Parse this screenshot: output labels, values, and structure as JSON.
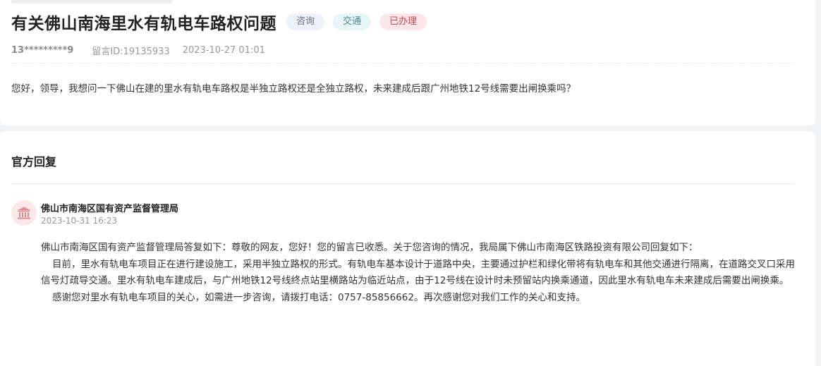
{
  "question": {
    "title": "有关佛山南海里水有轨电车路权问题",
    "tags": [
      "咨询",
      "交通",
      "已办理"
    ],
    "phone": "13*********9",
    "message_id": "留言ID:19135933",
    "date": "2023-10-27 01:01",
    "content": "您好，领导，我想问一下佛山在建的里水有轨电车路权是半独立路权还是全独立路权，未来建成后跟广州地铁12号线需要出闸换乘吗？"
  },
  "reply": {
    "section_title": "官方回复",
    "avatar_icon": "government-building-icon",
    "org": "佛山市南海区国有资产监督管理局",
    "date": "2023-10-31 16:23",
    "paragraphs": [
      "佛山市南海区国有资产监督管理局答复如下：尊敬的网友，您好！您的留言已收悉。关于您咨询的情况，我局属下佛山市南海区铁路投资有限公司回复如下：",
      "目前，里水有轨电车项目正在进行建设施工，采用半独立路权的形式。有轨电车基本设计于道路中央，主要通过护栏和绿化带将有轨电车和其他交通进行隔离，在道路交叉口采用信号灯疏导交通。里水有轨电车建成后，与广州地铁12号线终点站里横路站为临近站点，由于12号线在设计时未预留站内换乘通道，因此里水有轨电车未来建成后需要出闸换乘。",
      "感谢您对里水有轨电车项目的关心，如需进一步咨询，请拨打电话：0757-85856662。再次感谢您对我们工作的关心和支持。"
    ]
  },
  "colors": {
    "tag_consult_bg": "#eef1f7",
    "tag_traffic_bg": "#e9f6f7",
    "tag_done_bg": "#fbe7e9",
    "tag_done_text": "#c24a58",
    "avatar_bg": "#fbe9ea",
    "avatar_icon": "#e08a92"
  }
}
